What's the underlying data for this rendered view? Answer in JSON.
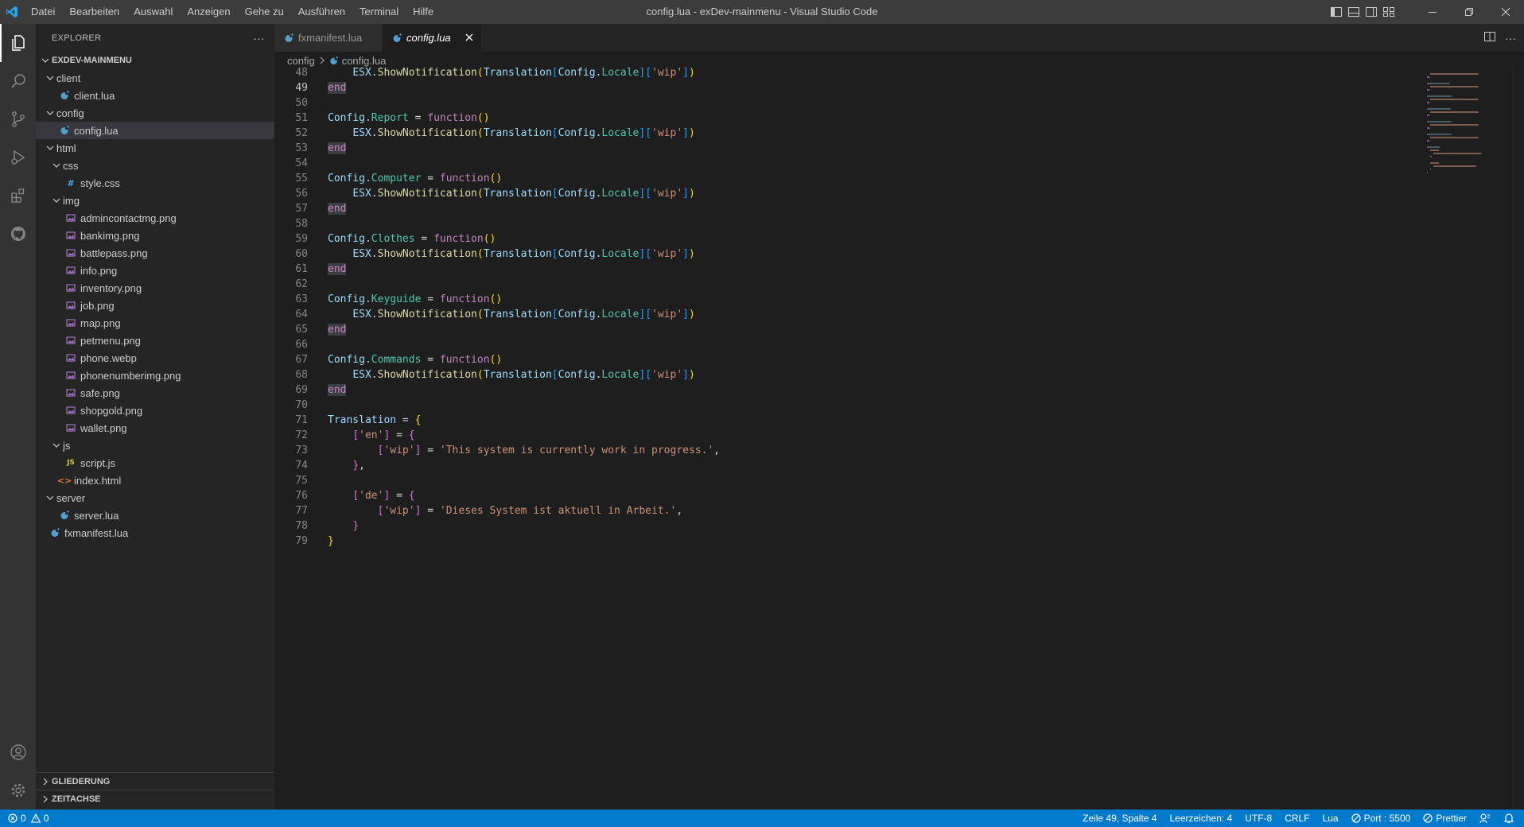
{
  "window": {
    "title": "config.lua - exDev-mainmenu - Visual Studio Code",
    "menu": [
      "Datei",
      "Bearbeiten",
      "Auswahl",
      "Anzeigen",
      "Gehe zu",
      "Ausführen",
      "Terminal",
      "Hilfe"
    ]
  },
  "sidebar": {
    "header": "EXPLORER",
    "root": "EXDEV-MAINMENU",
    "tree": [
      {
        "label": "client",
        "type": "folder",
        "depth": 1
      },
      {
        "label": "client.lua",
        "type": "lua",
        "depth": 2
      },
      {
        "label": "config",
        "type": "folder",
        "depth": 1
      },
      {
        "label": "config.lua",
        "type": "lua",
        "depth": 2,
        "selected": true
      },
      {
        "label": "html",
        "type": "folder",
        "depth": 1
      },
      {
        "label": "css",
        "type": "folder",
        "depth": 2
      },
      {
        "label": "style.css",
        "type": "css",
        "depth": 3
      },
      {
        "label": "img",
        "type": "folder",
        "depth": 2
      },
      {
        "label": "admincontactmg.png",
        "type": "png",
        "depth": 3
      },
      {
        "label": "bankimg.png",
        "type": "png",
        "depth": 3
      },
      {
        "label": "battlepass.png",
        "type": "png",
        "depth": 3
      },
      {
        "label": "info.png",
        "type": "png",
        "depth": 3
      },
      {
        "label": "inventory.png",
        "type": "png",
        "depth": 3
      },
      {
        "label": "job.png",
        "type": "png",
        "depth": 3
      },
      {
        "label": "map.png",
        "type": "png",
        "depth": 3
      },
      {
        "label": "petmenu.png",
        "type": "png",
        "depth": 3
      },
      {
        "label": "phone.webp",
        "type": "png",
        "depth": 3
      },
      {
        "label": "phonenumberimg.png",
        "type": "png",
        "depth": 3
      },
      {
        "label": "safe.png",
        "type": "png",
        "depth": 3
      },
      {
        "label": "shopgold.png",
        "type": "png",
        "depth": 3
      },
      {
        "label": "wallet.png",
        "type": "png",
        "depth": 3
      },
      {
        "label": "js",
        "type": "folder",
        "depth": 2
      },
      {
        "label": "script.js",
        "type": "js",
        "depth": 3
      },
      {
        "label": "index.html",
        "type": "html",
        "depth": 2
      },
      {
        "label": "server",
        "type": "folder",
        "depth": 1
      },
      {
        "label": "server.lua",
        "type": "lua",
        "depth": 2
      },
      {
        "label": "fxmanifest.lua",
        "type": "lua",
        "depth": 1
      }
    ],
    "outline": "GLIEDERUNG",
    "timeline": "ZEITACHSE"
  },
  "tabs": [
    {
      "label": "fxmanifest.lua",
      "active": false
    },
    {
      "label": "config.lua",
      "active": true
    }
  ],
  "breadcrumb": {
    "folder": "config",
    "file": "config.lua"
  },
  "editor": {
    "current_line": 49,
    "first_line": 48,
    "lines": [
      "    ESX.ShowNotification(Translation[Config.Locale]['wip'])",
      "end",
      "",
      "Config.Report = function()",
      "    ESX.ShowNotification(Translation[Config.Locale]['wip'])",
      "end",
      "",
      "Config.Computer = function()",
      "    ESX.ShowNotification(Translation[Config.Locale]['wip'])",
      "end",
      "",
      "Config.Clothes = function()",
      "    ESX.ShowNotification(Translation[Config.Locale]['wip'])",
      "end",
      "",
      "Config.Keyguide = function()",
      "    ESX.ShowNotification(Translation[Config.Locale]['wip'])",
      "end",
      "",
      "Config.Commands = function()",
      "    ESX.ShowNotification(Translation[Config.Locale]['wip'])",
      "end",
      "",
      "Translation = {",
      "    ['en'] = {",
      "        ['wip'] = 'This system is currently work in progress.',",
      "    },",
      "",
      "    ['de'] = {",
      "        ['wip'] = 'Dieses System ist aktuell in Arbeit.',",
      "    }",
      "}"
    ]
  },
  "statusbar": {
    "errors": "0",
    "warnings": "0",
    "position": "Zeile 49, Spalte 4",
    "indent": "Leerzeichen: 4",
    "encoding": "UTF-8",
    "eol": "CRLF",
    "language": "Lua",
    "port": "Port : 5500",
    "prettier": "Prettier"
  },
  "colors": {
    "statusbar": "#007acc",
    "activitybar": "#333333",
    "sidebar": "#252526",
    "editor": "#1e1e1e",
    "vscode_blue": "#23a9f2",
    "lua_icon": "#51a0cf"
  }
}
